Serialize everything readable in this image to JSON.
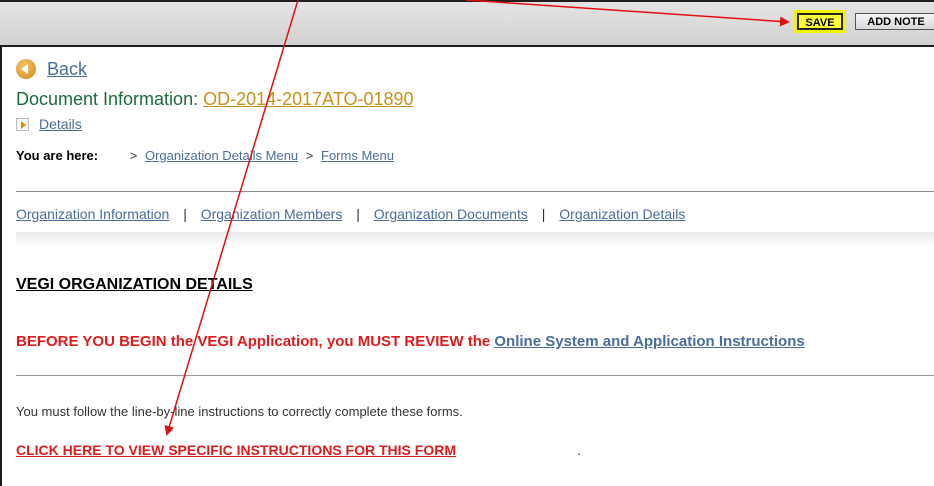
{
  "toolbar": {
    "save_label": "SAVE",
    "add_note_label": "ADD NOTE"
  },
  "nav": {
    "back_label": "Back",
    "document_info_label": "Document Information:",
    "document_id": "OD-2014-2017ATO-01890",
    "details_label": "Details"
  },
  "breadcrumb": {
    "label": "You are here:",
    "separator": ">",
    "items": [
      "Organization Details Menu",
      "Forms Menu"
    ]
  },
  "tabs": {
    "separator": "|",
    "items": [
      "Organization Information",
      "Organization Members",
      "Organization Documents",
      "Organization Details"
    ]
  },
  "content": {
    "section_title": "VEGI ORGANIZATION DETAILS",
    "warning_text": "BEFORE YOU BEGIN the VEGI Application, you MUST REVIEW the",
    "instructions_link": "Online System and Application Instructions",
    "follow_text": "You must follow the line-by-line instructions to correctly complete these forms.",
    "click_here_link": "CLICK HERE TO VIEW SPECIFIC INSTRUCTIONS FOR THIS FORM",
    "period": "."
  },
  "colors": {
    "annotation_arrow": "#e01010",
    "save_highlight": "#ffff33",
    "link_blue": "#4a6d9c",
    "doc_green": "#1b6b3a",
    "doc_id_gold": "#c8911a",
    "warning_red": "#e01b1b"
  },
  "icons": {
    "back": "back-circle-icon",
    "details": "expand-arrow-icon"
  }
}
